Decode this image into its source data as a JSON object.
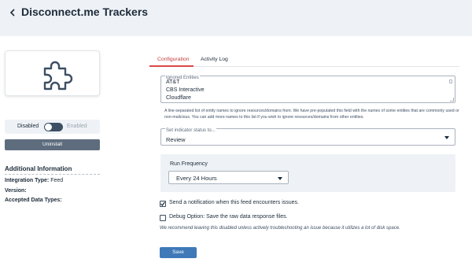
{
  "header": {
    "title": "Disconnect.me Trackers",
    "back_icon": "chevron-left-icon"
  },
  "sidebar": {
    "feed_icon": "puzzle-piece-icon",
    "toggle": {
      "off_label": "Disabled",
      "on_label": "Enabled",
      "state": "disabled"
    },
    "uninstall_label": "Uninstall",
    "info": {
      "heading": "Additional Information",
      "integration_type_label": "Integration Type:",
      "integration_type_value": "Feed",
      "version_label": "Version:",
      "accepted_types_label": "Accepted Data Types:"
    }
  },
  "tabs": [
    {
      "label": "Configuration",
      "active": true
    },
    {
      "label": "Activity Log",
      "active": false
    }
  ],
  "form": {
    "ignored_entities": {
      "label": "Ignored Entities",
      "lines": [
        "AT&T",
        "CBS Interactive",
        "Cloudflare"
      ],
      "help": "A line-separated list of entity names to ignore resources/domains from. We have pre-populated this field with the names of some entities that are commonly used or non-malicious. You can add more names to this list if you wish to ignore resources/domains from other entities."
    },
    "indicator_status": {
      "label": "Set indicator status to...",
      "value": "Review"
    },
    "run_frequency": {
      "label": "Run Frequency",
      "value": "Every 24 Hours"
    },
    "notify": {
      "label": "Send a notification when this feed encounters issues.",
      "checked": true
    },
    "debug": {
      "label": "Debug Option: Save the raw data response files.",
      "checked": false,
      "note": "We recommend leaving this disabled unless actively troubleshooting an issue because it utilizes a lot of disk space."
    },
    "save_label": "Save"
  },
  "colors": {
    "accent": "#3f79b8",
    "active_tab": "#d94848",
    "header_bg": "#eef2f6",
    "dark_button": "#5e6d7e"
  }
}
